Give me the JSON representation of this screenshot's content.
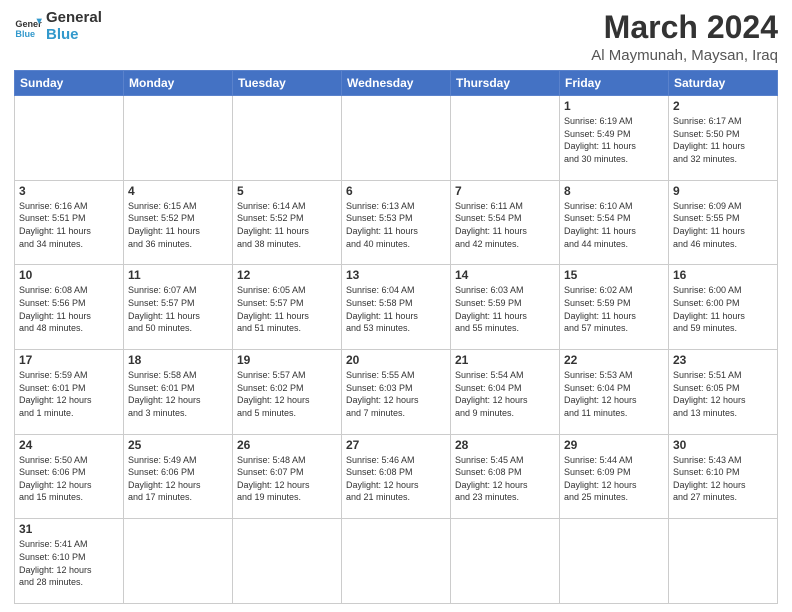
{
  "logo": {
    "text_general": "General",
    "text_blue": "Blue"
  },
  "title": {
    "month": "March 2024",
    "location": "Al Maymunah, Maysan, Iraq"
  },
  "header_days": [
    "Sunday",
    "Monday",
    "Tuesday",
    "Wednesday",
    "Thursday",
    "Friday",
    "Saturday"
  ],
  "weeks": [
    {
      "days": [
        {
          "num": "",
          "info": ""
        },
        {
          "num": "",
          "info": ""
        },
        {
          "num": "",
          "info": ""
        },
        {
          "num": "",
          "info": ""
        },
        {
          "num": "",
          "info": ""
        },
        {
          "num": "1",
          "info": "Sunrise: 6:19 AM\nSunset: 5:49 PM\nDaylight: 11 hours\nand 30 minutes."
        },
        {
          "num": "2",
          "info": "Sunrise: 6:17 AM\nSunset: 5:50 PM\nDaylight: 11 hours\nand 32 minutes."
        }
      ]
    },
    {
      "days": [
        {
          "num": "3",
          "info": "Sunrise: 6:16 AM\nSunset: 5:51 PM\nDaylight: 11 hours\nand 34 minutes."
        },
        {
          "num": "4",
          "info": "Sunrise: 6:15 AM\nSunset: 5:52 PM\nDaylight: 11 hours\nand 36 minutes."
        },
        {
          "num": "5",
          "info": "Sunrise: 6:14 AM\nSunset: 5:52 PM\nDaylight: 11 hours\nand 38 minutes."
        },
        {
          "num": "6",
          "info": "Sunrise: 6:13 AM\nSunset: 5:53 PM\nDaylight: 11 hours\nand 40 minutes."
        },
        {
          "num": "7",
          "info": "Sunrise: 6:11 AM\nSunset: 5:54 PM\nDaylight: 11 hours\nand 42 minutes."
        },
        {
          "num": "8",
          "info": "Sunrise: 6:10 AM\nSunset: 5:54 PM\nDaylight: 11 hours\nand 44 minutes."
        },
        {
          "num": "9",
          "info": "Sunrise: 6:09 AM\nSunset: 5:55 PM\nDaylight: 11 hours\nand 46 minutes."
        }
      ]
    },
    {
      "days": [
        {
          "num": "10",
          "info": "Sunrise: 6:08 AM\nSunset: 5:56 PM\nDaylight: 11 hours\nand 48 minutes."
        },
        {
          "num": "11",
          "info": "Sunrise: 6:07 AM\nSunset: 5:57 PM\nDaylight: 11 hours\nand 50 minutes."
        },
        {
          "num": "12",
          "info": "Sunrise: 6:05 AM\nSunset: 5:57 PM\nDaylight: 11 hours\nand 51 minutes."
        },
        {
          "num": "13",
          "info": "Sunrise: 6:04 AM\nSunset: 5:58 PM\nDaylight: 11 hours\nand 53 minutes."
        },
        {
          "num": "14",
          "info": "Sunrise: 6:03 AM\nSunset: 5:59 PM\nDaylight: 11 hours\nand 55 minutes."
        },
        {
          "num": "15",
          "info": "Sunrise: 6:02 AM\nSunset: 5:59 PM\nDaylight: 11 hours\nand 57 minutes."
        },
        {
          "num": "16",
          "info": "Sunrise: 6:00 AM\nSunset: 6:00 PM\nDaylight: 11 hours\nand 59 minutes."
        }
      ]
    },
    {
      "days": [
        {
          "num": "17",
          "info": "Sunrise: 5:59 AM\nSunset: 6:01 PM\nDaylight: 12 hours\nand 1 minute."
        },
        {
          "num": "18",
          "info": "Sunrise: 5:58 AM\nSunset: 6:01 PM\nDaylight: 12 hours\nand 3 minutes."
        },
        {
          "num": "19",
          "info": "Sunrise: 5:57 AM\nSunset: 6:02 PM\nDaylight: 12 hours\nand 5 minutes."
        },
        {
          "num": "20",
          "info": "Sunrise: 5:55 AM\nSunset: 6:03 PM\nDaylight: 12 hours\nand 7 minutes."
        },
        {
          "num": "21",
          "info": "Sunrise: 5:54 AM\nSunset: 6:04 PM\nDaylight: 12 hours\nand 9 minutes."
        },
        {
          "num": "22",
          "info": "Sunrise: 5:53 AM\nSunset: 6:04 PM\nDaylight: 12 hours\nand 11 minutes."
        },
        {
          "num": "23",
          "info": "Sunrise: 5:51 AM\nSunset: 6:05 PM\nDaylight: 12 hours\nand 13 minutes."
        }
      ]
    },
    {
      "days": [
        {
          "num": "24",
          "info": "Sunrise: 5:50 AM\nSunset: 6:06 PM\nDaylight: 12 hours\nand 15 minutes."
        },
        {
          "num": "25",
          "info": "Sunrise: 5:49 AM\nSunset: 6:06 PM\nDaylight: 12 hours\nand 17 minutes."
        },
        {
          "num": "26",
          "info": "Sunrise: 5:48 AM\nSunset: 6:07 PM\nDaylight: 12 hours\nand 19 minutes."
        },
        {
          "num": "27",
          "info": "Sunrise: 5:46 AM\nSunset: 6:08 PM\nDaylight: 12 hours\nand 21 minutes."
        },
        {
          "num": "28",
          "info": "Sunrise: 5:45 AM\nSunset: 6:08 PM\nDaylight: 12 hours\nand 23 minutes."
        },
        {
          "num": "29",
          "info": "Sunrise: 5:44 AM\nSunset: 6:09 PM\nDaylight: 12 hours\nand 25 minutes."
        },
        {
          "num": "30",
          "info": "Sunrise: 5:43 AM\nSunset: 6:10 PM\nDaylight: 12 hours\nand 27 minutes."
        }
      ]
    },
    {
      "days": [
        {
          "num": "31",
          "info": "Sunrise: 5:41 AM\nSunset: 6:10 PM\nDaylight: 12 hours\nand 28 minutes."
        },
        {
          "num": "",
          "info": ""
        },
        {
          "num": "",
          "info": ""
        },
        {
          "num": "",
          "info": ""
        },
        {
          "num": "",
          "info": ""
        },
        {
          "num": "",
          "info": ""
        },
        {
          "num": "",
          "info": ""
        }
      ]
    }
  ]
}
